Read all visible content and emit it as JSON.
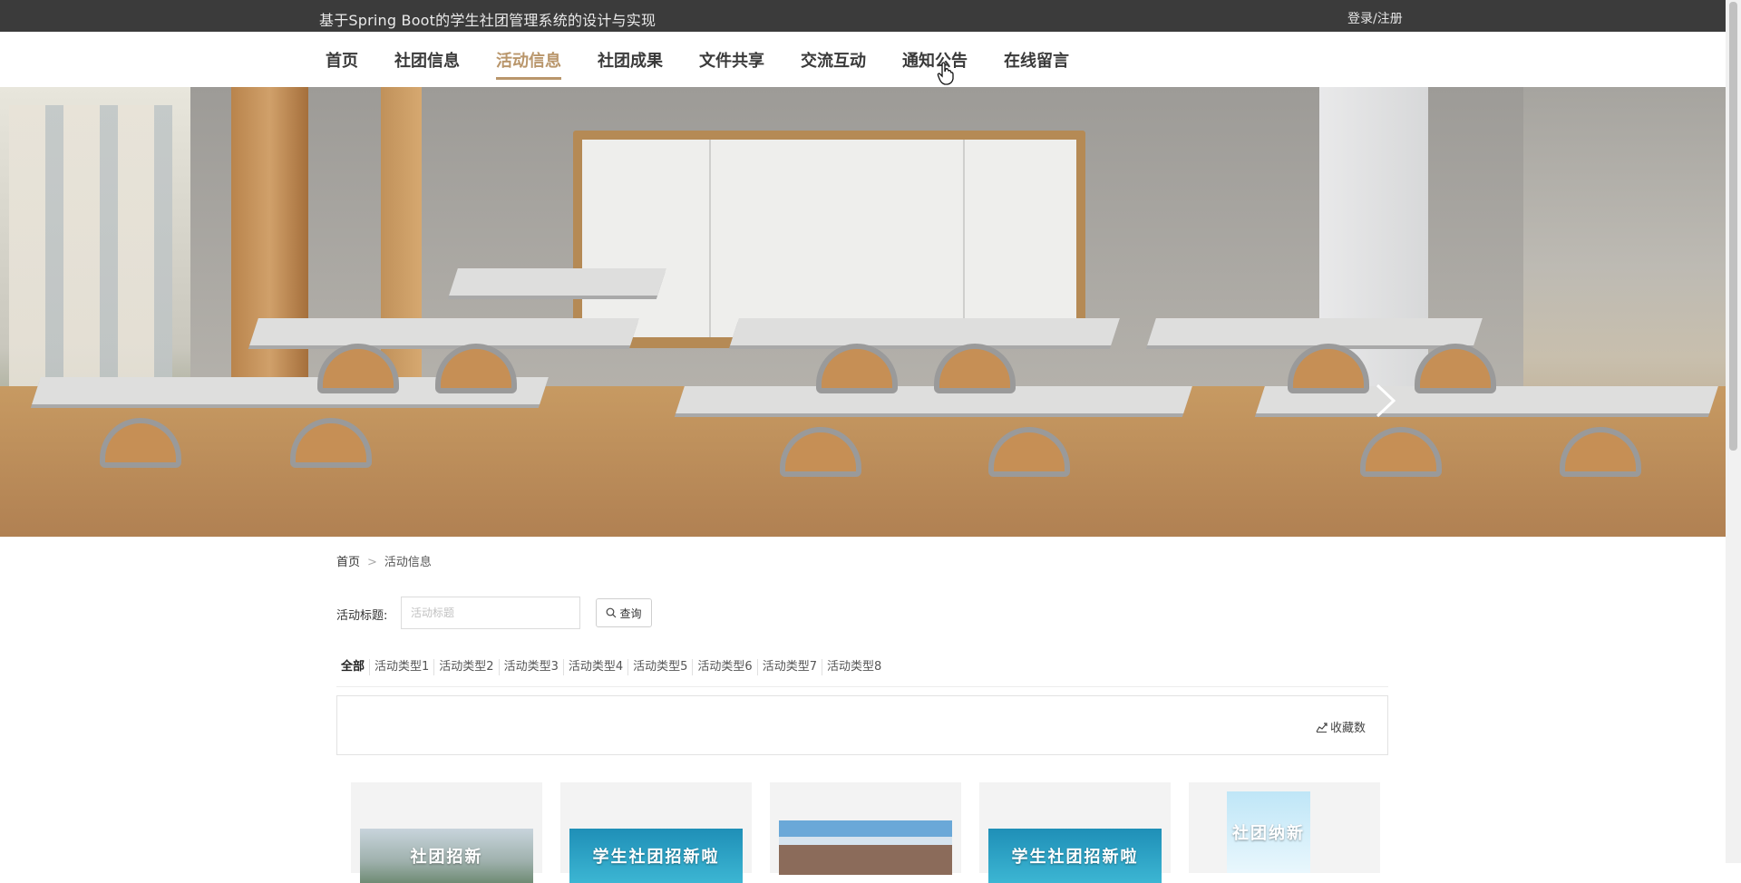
{
  "header": {
    "site_title": "基于Spring Boot的学生社团管理系统的设计与实现",
    "login_label": "登录/注册"
  },
  "nav": {
    "items": [
      {
        "label": "首页"
      },
      {
        "label": "社团信息"
      },
      {
        "label": "活动信息",
        "active": true
      },
      {
        "label": "社团成果"
      },
      {
        "label": "文件共享"
      },
      {
        "label": "交流互动"
      },
      {
        "label": "通知公告"
      },
      {
        "label": "在线留言"
      }
    ]
  },
  "banner": {
    "slide_count": 3,
    "active_slide": 1,
    "next_icon": "chevron-right-icon"
  },
  "breadcrumb": {
    "home": "首页",
    "separator": ">",
    "current": "活动信息"
  },
  "search": {
    "label": "活动标题:",
    "placeholder": "活动标题",
    "value": "",
    "button_label": "查询",
    "button_icon": "search-icon"
  },
  "types": {
    "items": [
      "全部",
      "活动类型1",
      "活动类型2",
      "活动类型3",
      "活动类型4",
      "活动类型5",
      "活动类型6",
      "活动类型7",
      "活动类型8"
    ],
    "active_index": 0
  },
  "sort": {
    "label": "收藏数",
    "icon": "trend-chart-icon"
  },
  "cards": [
    {
      "thumb_text": "社团招新"
    },
    {
      "thumb_text": "学生社团招新啦"
    },
    {
      "thumb_text": ""
    },
    {
      "thumb_text": "学生社团招新啦"
    },
    {
      "thumb_text": "社团纳新"
    }
  ],
  "colors": {
    "topbar_bg": "#3b3b3b",
    "accent": "#b9966b"
  }
}
